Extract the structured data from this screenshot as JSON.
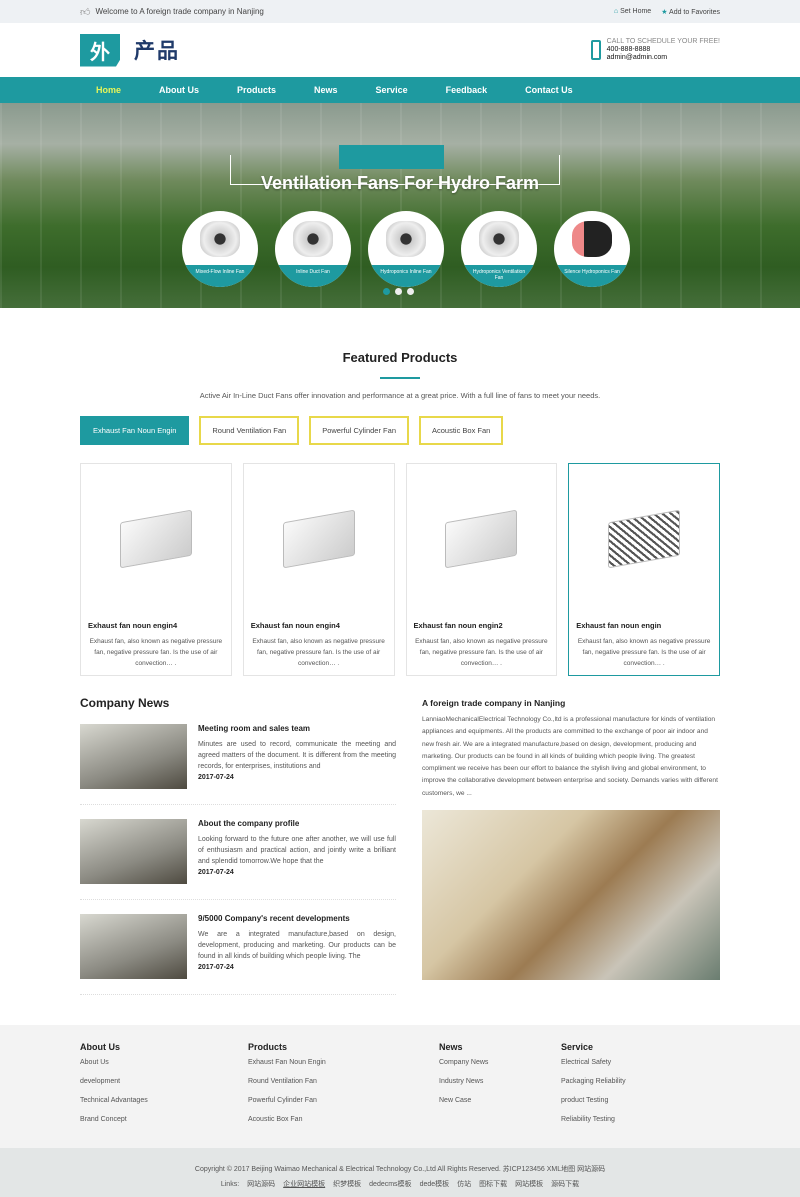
{
  "topbar": {
    "welcome": "Welcome to A foreign trade company in Nanjing",
    "set_home": "Set Home",
    "favorites": "Add to Favorites"
  },
  "header": {
    "logo_mark": "外",
    "logo_text": "产品",
    "call": "CALL TO SCHEDULE YOUR FREE!",
    "phone": "400-888-8888",
    "email": "admin@admin.com"
  },
  "nav": [
    "Home",
    "About Us",
    "Products",
    "News",
    "Service",
    "Feedback",
    "Contact Us"
  ],
  "hero": {
    "title": "Ventilation Fans For Hydro Farm",
    "items": [
      "Mixed-Flow Inline Fan",
      "Inline Duct Fan",
      "Hydroponics Inline Fan",
      "Hydroponics Ventilation Fan",
      "Silence Hydroponics Fan"
    ],
    "active_slide": 1,
    "slide_count": 3
  },
  "featured": {
    "title": "Featured Products",
    "desc": "Active Air In-Line Duct Fans offer innovation and performance at a great price. With a full line of fans to meet your needs.",
    "tabs": [
      "Exhaust Fan Noun Engin",
      "Round Ventilation Fan",
      "Powerful Cylinder Fan",
      "Acoustic Box Fan"
    ],
    "products": [
      {
        "name": "Exhaust fan noun engin4",
        "desc": "Exhaust fan, also known as negative pressure fan, negative pressure fan. Is the use of air convection… ."
      },
      {
        "name": "Exhaust fan noun engin4",
        "desc": "Exhaust fan, also known as negative pressure fan, negative pressure fan. Is the use of air convection… ."
      },
      {
        "name": "Exhaust fan noun engin2",
        "desc": "Exhaust fan, also known as negative pressure fan, negative pressure fan. Is the use of air convection… ."
      },
      {
        "name": "Exhaust fan noun engin",
        "desc": "Exhaust fan, also known as negative pressure fan, negative pressure fan. Is the use of air convection… ."
      }
    ]
  },
  "news": {
    "title": "Company News",
    "items": [
      {
        "title": "Meeting room and sales team",
        "text": "Minutes are used to record, communicate the meeting and agreed matters of the document. It is different from the meeting records, for enterprises, institutions and",
        "date": "2017-07-24"
      },
      {
        "title": "About the company profile",
        "text": "Looking forward to the future one after another, we will use full of enthusiasm and practical action, and jointly write a brilliant and splendid tomorrow.We hope that the",
        "date": "2017-07-24"
      },
      {
        "title": "9/5000 Company's recent developments",
        "text": "We are a integrated manufacture,based on design, development, producing and marketing. Our products can be found in all kinds of building which people living. The",
        "date": "2017-07-24"
      }
    ]
  },
  "about": {
    "title": "A foreign trade company in Nanjing",
    "text": "LanniaoMechanicalElectrical Technology Co.,ltd is a professional manufacture for kinds of ventilation appliances and equipments. All the products are committed to the exchange of poor air indoor and new fresh air. We are a integrated manufacture,based on design, development, producing and marketing. Our products can be found in all kinds of building which people living. The greatest compliment we receive has been our effort to balance the stylish living and global environment, to improve the collaborative development between enterprise and society. Demands varies with different customers, we ..."
  },
  "footer": {
    "cols": [
      {
        "title": "About Us",
        "links": [
          "About Us",
          "development",
          "Technical Advantages",
          "Brand Concept"
        ]
      },
      {
        "title": "Products",
        "links": [
          "Exhaust Fan Noun Engin",
          "Round Ventilation Fan",
          "Powerful Cylinder Fan",
          "Acoustic Box Fan"
        ]
      },
      {
        "title": "News",
        "links": [
          "Company News",
          "Industry News",
          "New Case"
        ]
      },
      {
        "title": "Service",
        "links": [
          "Electrical Safety",
          "Packaging Reliability",
          "product Testing",
          "Reliability Testing"
        ]
      }
    ],
    "copyright": "Copyright © 2017 Beijing Waimao Mechanical & Electrical Technology Co.,Ltd All Rights Reserved. 苏ICP123456 XML地图 网站源码",
    "links_label": "Links:",
    "links": [
      "网站源码",
      "企业网站模板",
      "织梦模板",
      "dedecms模板",
      "dede模板",
      "仿站",
      "图标下载",
      "网站模板",
      "源码下载"
    ]
  }
}
